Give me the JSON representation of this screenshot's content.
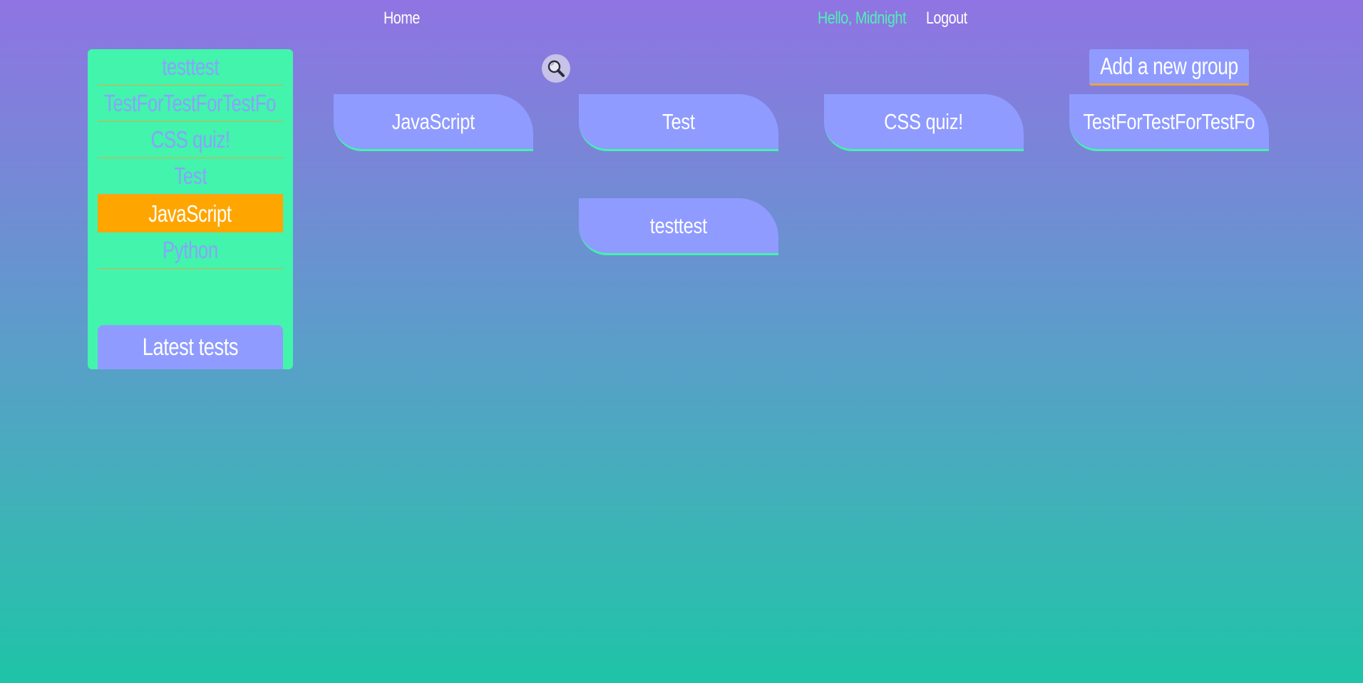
{
  "header": {
    "home_label": "Home",
    "greeting": "Hello, Midnight",
    "logout_label": "Logout"
  },
  "sidebar": {
    "items": [
      {
        "label": "testtest",
        "active": false
      },
      {
        "label": "TestForTestForTestFo",
        "active": false
      },
      {
        "label": "CSS quiz!",
        "active": false
      },
      {
        "label": "Test",
        "active": false
      },
      {
        "label": "JavaScript",
        "active": true
      },
      {
        "label": "Python",
        "active": false
      }
    ],
    "latest_tests_label": "Latest tests"
  },
  "toolbar": {
    "search_icon": "magnifier-icon",
    "add_group_label": "Add a new group"
  },
  "groups": [
    {
      "label": "JavaScript"
    },
    {
      "label": "Test"
    },
    {
      "label": "CSS quiz!"
    },
    {
      "label": "TestForTestForTestFo"
    },
    {
      "label": "testtest"
    }
  ],
  "colors": {
    "sidebar_bg": "#42f4ac",
    "card_bg": "#8f9bff",
    "active_item": "#ffa500",
    "divider": "#f0a340",
    "greeting_text": "#4ef2b5"
  }
}
